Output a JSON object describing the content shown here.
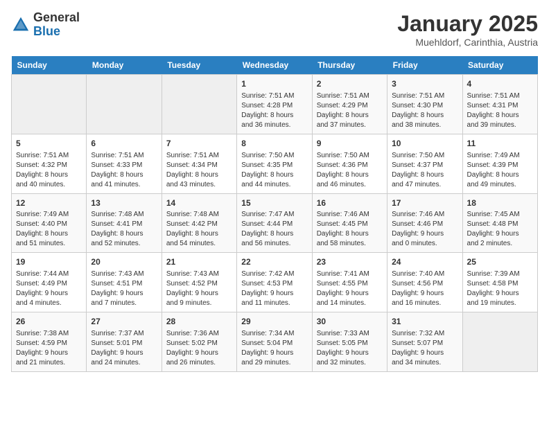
{
  "header": {
    "logo_general": "General",
    "logo_blue": "Blue",
    "month_title": "January 2025",
    "location": "Muehldorf, Carinthia, Austria"
  },
  "weekdays": [
    "Sunday",
    "Monday",
    "Tuesday",
    "Wednesday",
    "Thursday",
    "Friday",
    "Saturday"
  ],
  "weeks": [
    [
      {
        "day": "",
        "info": ""
      },
      {
        "day": "",
        "info": ""
      },
      {
        "day": "",
        "info": ""
      },
      {
        "day": "1",
        "info": "Sunrise: 7:51 AM\nSunset: 4:28 PM\nDaylight: 8 hours\nand 36 minutes."
      },
      {
        "day": "2",
        "info": "Sunrise: 7:51 AM\nSunset: 4:29 PM\nDaylight: 8 hours\nand 37 minutes."
      },
      {
        "day": "3",
        "info": "Sunrise: 7:51 AM\nSunset: 4:30 PM\nDaylight: 8 hours\nand 38 minutes."
      },
      {
        "day": "4",
        "info": "Sunrise: 7:51 AM\nSunset: 4:31 PM\nDaylight: 8 hours\nand 39 minutes."
      }
    ],
    [
      {
        "day": "5",
        "info": "Sunrise: 7:51 AM\nSunset: 4:32 PM\nDaylight: 8 hours\nand 40 minutes."
      },
      {
        "day": "6",
        "info": "Sunrise: 7:51 AM\nSunset: 4:33 PM\nDaylight: 8 hours\nand 41 minutes."
      },
      {
        "day": "7",
        "info": "Sunrise: 7:51 AM\nSunset: 4:34 PM\nDaylight: 8 hours\nand 43 minutes."
      },
      {
        "day": "8",
        "info": "Sunrise: 7:50 AM\nSunset: 4:35 PM\nDaylight: 8 hours\nand 44 minutes."
      },
      {
        "day": "9",
        "info": "Sunrise: 7:50 AM\nSunset: 4:36 PM\nDaylight: 8 hours\nand 46 minutes."
      },
      {
        "day": "10",
        "info": "Sunrise: 7:50 AM\nSunset: 4:37 PM\nDaylight: 8 hours\nand 47 minutes."
      },
      {
        "day": "11",
        "info": "Sunrise: 7:49 AM\nSunset: 4:39 PM\nDaylight: 8 hours\nand 49 minutes."
      }
    ],
    [
      {
        "day": "12",
        "info": "Sunrise: 7:49 AM\nSunset: 4:40 PM\nDaylight: 8 hours\nand 51 minutes."
      },
      {
        "day": "13",
        "info": "Sunrise: 7:48 AM\nSunset: 4:41 PM\nDaylight: 8 hours\nand 52 minutes."
      },
      {
        "day": "14",
        "info": "Sunrise: 7:48 AM\nSunset: 4:42 PM\nDaylight: 8 hours\nand 54 minutes."
      },
      {
        "day": "15",
        "info": "Sunrise: 7:47 AM\nSunset: 4:44 PM\nDaylight: 8 hours\nand 56 minutes."
      },
      {
        "day": "16",
        "info": "Sunrise: 7:46 AM\nSunset: 4:45 PM\nDaylight: 8 hours\nand 58 minutes."
      },
      {
        "day": "17",
        "info": "Sunrise: 7:46 AM\nSunset: 4:46 PM\nDaylight: 9 hours\nand 0 minutes."
      },
      {
        "day": "18",
        "info": "Sunrise: 7:45 AM\nSunset: 4:48 PM\nDaylight: 9 hours\nand 2 minutes."
      }
    ],
    [
      {
        "day": "19",
        "info": "Sunrise: 7:44 AM\nSunset: 4:49 PM\nDaylight: 9 hours\nand 4 minutes."
      },
      {
        "day": "20",
        "info": "Sunrise: 7:43 AM\nSunset: 4:51 PM\nDaylight: 9 hours\nand 7 minutes."
      },
      {
        "day": "21",
        "info": "Sunrise: 7:43 AM\nSunset: 4:52 PM\nDaylight: 9 hours\nand 9 minutes."
      },
      {
        "day": "22",
        "info": "Sunrise: 7:42 AM\nSunset: 4:53 PM\nDaylight: 9 hours\nand 11 minutes."
      },
      {
        "day": "23",
        "info": "Sunrise: 7:41 AM\nSunset: 4:55 PM\nDaylight: 9 hours\nand 14 minutes."
      },
      {
        "day": "24",
        "info": "Sunrise: 7:40 AM\nSunset: 4:56 PM\nDaylight: 9 hours\nand 16 minutes."
      },
      {
        "day": "25",
        "info": "Sunrise: 7:39 AM\nSunset: 4:58 PM\nDaylight: 9 hours\nand 19 minutes."
      }
    ],
    [
      {
        "day": "26",
        "info": "Sunrise: 7:38 AM\nSunset: 4:59 PM\nDaylight: 9 hours\nand 21 minutes."
      },
      {
        "day": "27",
        "info": "Sunrise: 7:37 AM\nSunset: 5:01 PM\nDaylight: 9 hours\nand 24 minutes."
      },
      {
        "day": "28",
        "info": "Sunrise: 7:36 AM\nSunset: 5:02 PM\nDaylight: 9 hours\nand 26 minutes."
      },
      {
        "day": "29",
        "info": "Sunrise: 7:34 AM\nSunset: 5:04 PM\nDaylight: 9 hours\nand 29 minutes."
      },
      {
        "day": "30",
        "info": "Sunrise: 7:33 AM\nSunset: 5:05 PM\nDaylight: 9 hours\nand 32 minutes."
      },
      {
        "day": "31",
        "info": "Sunrise: 7:32 AM\nSunset: 5:07 PM\nDaylight: 9 hours\nand 34 minutes."
      },
      {
        "day": "",
        "info": ""
      }
    ]
  ]
}
